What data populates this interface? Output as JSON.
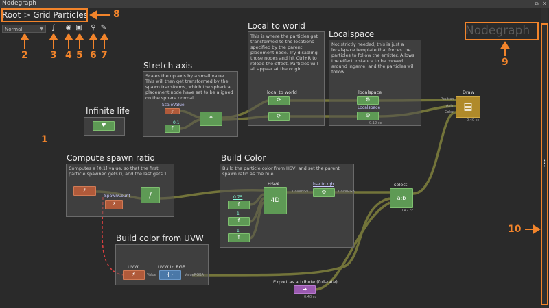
{
  "window": {
    "title": "Nodegraph",
    "pin_icon": "pin-icon",
    "close_label": "✕"
  },
  "breadcrumb": {
    "root": "Root",
    "separator": ">",
    "current": "Grid Particles"
  },
  "toolbar": {
    "mode": "Normal"
  },
  "watermark": "Nodegraph",
  "comments": {
    "local_to_world": {
      "title": "Local to world",
      "text": "This is where the particles get transformed to the locations specified by the parent placement node. Try disabling those nodes and hit Ctrl+R to reload the effect. Particles will all appear at the origin."
    },
    "localspace": {
      "title": "Localspace",
      "text": "Not strictly needed, this is just a localspace template that forces the particles to follow the emitter. Allows the effect instance to be moved around ingame, and the particles will follow."
    },
    "stretch_axis": {
      "title": "Stretch axis",
      "text": "Scales the up axis by a small value. This will then get transformed by the spawn transforms, which the spherical placement node have set to be aligned on the sphere normal."
    },
    "infinite_life": {
      "title": "Infinite life"
    },
    "compute_spawn": {
      "title": "Compute spawn ratio",
      "text": "Computes a [0,1] value, so that the first particle spawned gets 0, and the last gets 1"
    },
    "build_color": {
      "title": "Build Color",
      "text": "Build the particle color from HSV, and set the parent spawn ratio as the hue."
    },
    "build_uvw": {
      "title": "Build color from UVW"
    }
  },
  "nodes": {
    "local_to_world": "local to world",
    "localspace": "localspace",
    "localspace_param": "Localspace",
    "draw": "Draw",
    "draw_ports": [
      "Position",
      "Axis",
      "Color"
    ],
    "scale_param": "ScaleValue",
    "value_01": "0.1",
    "hsva": "HSVA",
    "hsva_op": "4D",
    "hsv_to_rgb": "hsv to rgb",
    "color_hsv": "ColorHSV",
    "color_rgb": "ColorRGB",
    "value_075": "0.75",
    "value_1a": "1",
    "value_1b": "1",
    "spawn_count": "SpawnCount",
    "select": "select",
    "select_op": "a:b",
    "uvw": "UVW",
    "uvw_to_rgb": "UVW to RGB",
    "value_port": "Value",
    "value_rgba": "ValueRGBA",
    "export_attr": "Export as attribute (full-rate)",
    "divide": "/",
    "multiply": "*",
    "f1": "f",
    "timings": [
      "0.40 cc",
      "0.42 cc",
      "0.40 cc",
      "0.12 cc"
    ]
  },
  "annotations": [
    "1",
    "2",
    "3",
    "4",
    "5",
    "6",
    "7",
    "8",
    "9",
    "10"
  ],
  "colors": {
    "accent": "#f2842b",
    "node_green": "#5e9a55",
    "node_orange": "#b05a3a",
    "node_blue": "#4a78a8",
    "wire": "#7a7a3a"
  }
}
